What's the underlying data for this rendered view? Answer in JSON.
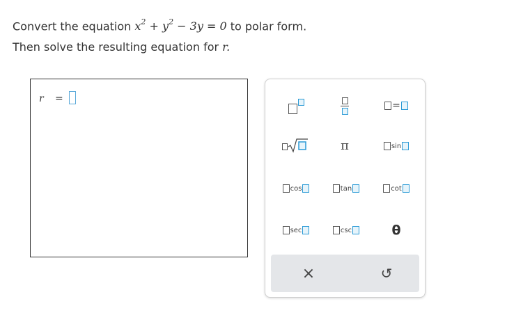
{
  "question": {
    "line1_prefix": "Convert the equation",
    "line1_suffix": "to polar form.",
    "line2_prefix": "Then solve the resulting equation for",
    "line2_var": "r.",
    "equation": {
      "x": "x",
      "y": "y",
      "exp": "2",
      "plus": "+",
      "minus": "−",
      "coef": "3y",
      "equals": "=",
      "zero": "0"
    }
  },
  "answer": {
    "variable": "r",
    "equals": "="
  },
  "palette": {
    "pi": "π",
    "equals": "=",
    "sin": "sin",
    "cos": "cos",
    "tan": "tan",
    "cot": "cot",
    "sec": "sec",
    "csc": "csc",
    "theta": "θ",
    "clear": "×",
    "undo": "↺"
  },
  "colors": {
    "accent": "#2a9ad6",
    "box_fill": "#e6f4fb",
    "bar_bg": "#e4e6e9"
  }
}
